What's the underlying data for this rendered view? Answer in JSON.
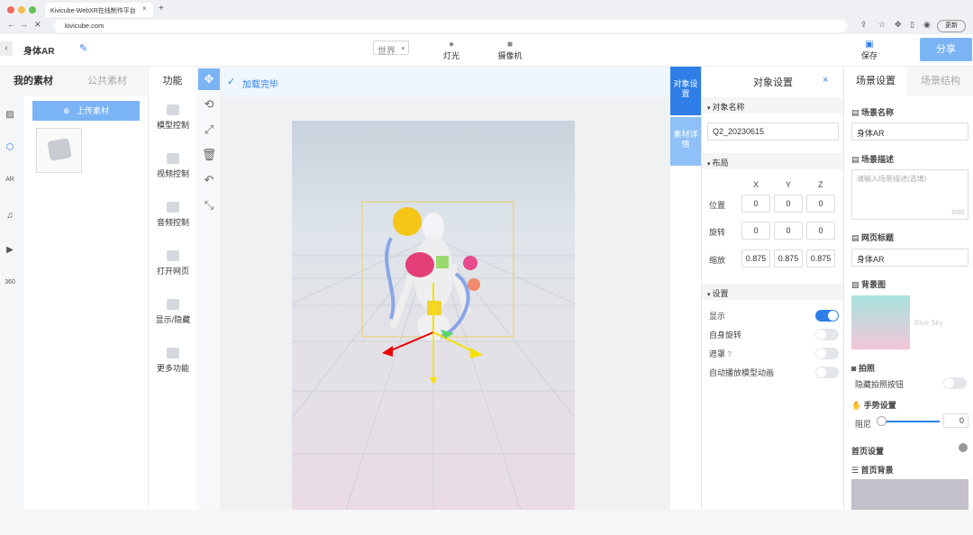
{
  "browser": {
    "tab_title": "Kivicube-WebXR在线制作平台",
    "url": "kivicube.com",
    "update_label": "更新"
  },
  "topbar": {
    "project_name": "身体AR",
    "world_select": "世界",
    "light_label": "灯光",
    "camera_label": "摄像机",
    "save_label": "保存",
    "share_label": "分享"
  },
  "assets": {
    "tab_mine": "我的素材",
    "tab_public": "公共素材",
    "upload_label": "上传素材"
  },
  "functions": {
    "title": "功能",
    "items": [
      "模型控制",
      "视频控制",
      "音频控制",
      "打开网页",
      "显示/隐藏",
      "更多功能"
    ]
  },
  "viewport": {
    "status": "加载完毕"
  },
  "side_tabs": {
    "object_settings": "对象设置",
    "asset_detail": "素材详情"
  },
  "object_panel": {
    "title": "对象设置",
    "name_section": "对象名称",
    "name_value": "Q2_20230615",
    "layout_section": "布局",
    "axis_x": "X",
    "axis_y": "Y",
    "axis_z": "Z",
    "position_label": "位置",
    "position": [
      "0",
      "0",
      "0"
    ],
    "rotation_label": "旋转",
    "rotation": [
      "0",
      "0",
      "0"
    ],
    "scale_label": "缩放",
    "scale": [
      "0.875",
      "0.875",
      "0.875"
    ],
    "settings_section": "设置",
    "show_label": "显示",
    "show_on": true,
    "self_rotate_label": "自身旋转",
    "self_rotate_on": false,
    "mask_label": "遮罩",
    "mask_on": false,
    "autoplay_label": "自动播放模型动画",
    "autoplay_on": false
  },
  "scene_panel": {
    "tab_settings": "场景设置",
    "tab_structure": "场景结构",
    "name_label": "场景名称",
    "name_value": "身体AR",
    "desc_label": "场景描述",
    "desc_placeholder": "请输入场景描述(选填)",
    "desc_count": "0/60",
    "page_title_label": "网页标题",
    "page_title_value": "身体AR",
    "bg_label": "背景图",
    "bg_name": "Blue Sky",
    "photo_label": "拍照",
    "hide_photo_label": "隐藏拍照按钮",
    "hide_photo_on": false,
    "gesture_label": "手势设置",
    "damping_label": "阻尼",
    "damping_value": "0",
    "home_label": "首页设置",
    "home_bg_label": "首页背景"
  },
  "colors": {
    "accent": "#2f7ee8",
    "accent_light": "#7ab4f5",
    "side_tab_active": "#2f7ee8",
    "side_tab_inactive": "#8fc0f7"
  }
}
